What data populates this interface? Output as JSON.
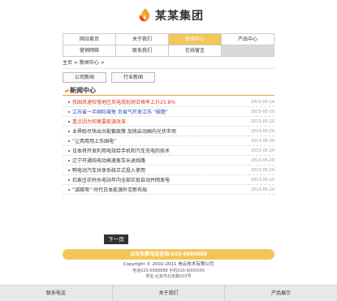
{
  "logo": {
    "name": "某某集团",
    "icon": "flame-logo-icon",
    "colors": [
      "#e8431a",
      "#f4a22d"
    ]
  },
  "nav": {
    "row1": [
      "网站首页",
      "关于我们",
      "新闻中心",
      "产品中心"
    ],
    "row2": [
      "营销网络",
      "联系我们",
      "在线留言",
      ""
    ],
    "active": "新闻中心"
  },
  "breadcrumb": "主页 > 新闻中心 >",
  "tabs": [
    "公司新闻",
    "行业新闻"
  ],
  "section_title": "新闻中心",
  "news": [
    {
      "title": "我国风速较慢地区风电规划测合格率上升25.8%",
      "date": "2015-05-14",
      "color": "red"
    },
    {
      "title": "江苏省一半国际城每 页省气开发江苏 “破题”",
      "date": "2015-05-20",
      "color": "blue"
    },
    {
      "title": "重点因为何菁要能源改革",
      "date": "2013-05-20",
      "color": "red"
    },
    {
      "title": "业界盼尽快出台配套政策 加快启动国内光伏市场",
      "date": "2013-05-20",
      "color": "normal"
    },
    {
      "title": "“让西用用上东国电”",
      "date": "2013-05-20",
      "color": "normal"
    },
    {
      "title": "日本将开发利用电效给手机和汽车充电的技术",
      "date": "2013-05-20",
      "color": "normal"
    },
    {
      "title": "辽宁开通纯电动高速客车长途线路",
      "date": "2013-05-20",
      "color": "normal"
    },
    {
      "title": "鸭电动汽车共享系统正式投入使用",
      "date": "2013-05-20",
      "color": "normal"
    },
    {
      "title": "石家庄农村水电站年内全部实现自动并网发电",
      "date": "2013-05-20",
      "color": "normal"
    },
    {
      "title": "“减碳电” 时代日本能源外交新布局",
      "date": "2013-05-20",
      "color": "normal"
    }
  ],
  "next_page": "下一页",
  "call_bar": "点击免费电话咨询:020-6888888",
  "footer": {
    "copyright": "Copyright © 2002-2011 电云技术有限公司",
    "phone": "电话020-6888888 手机020-6000000",
    "address": "地址:北京市北京路203号"
  },
  "bottom_nav": [
    "联系电话",
    "关于我们",
    "产品展示"
  ],
  "colors": {
    "accent": "#f4c65a",
    "red": "#e03b1c",
    "blue": "#1a4cb8"
  }
}
